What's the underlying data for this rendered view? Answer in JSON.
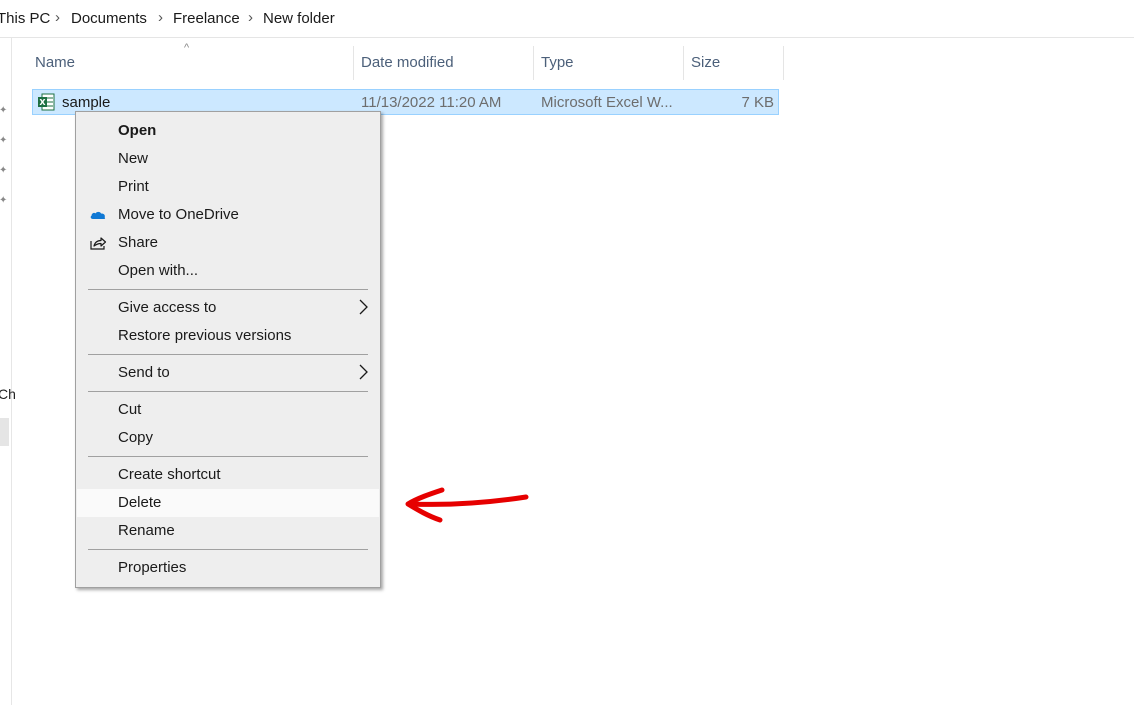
{
  "breadcrumb": {
    "items": [
      "This PC",
      "Documents",
      "Freelance",
      "New folder"
    ]
  },
  "nav": {
    "partial_text": "Ch"
  },
  "columns": {
    "name": "Name",
    "date_modified": "Date modified",
    "type": "Type",
    "size": "Size"
  },
  "file": {
    "name": "sample",
    "date_modified": "11/13/2022 11:20 AM",
    "type": "Microsoft Excel W...",
    "size": "7 KB",
    "icon": "excel-file-icon"
  },
  "context_menu": {
    "items": [
      {
        "label": "Open",
        "bold": true
      },
      {
        "label": "New"
      },
      {
        "label": "Print"
      },
      {
        "label": "Move to OneDrive",
        "icon": "onedrive-icon"
      },
      {
        "label": "Share",
        "icon": "share-icon"
      },
      {
        "label": "Open with..."
      },
      {
        "label": "Give access to",
        "submenu": true
      },
      {
        "label": "Restore previous versions"
      },
      {
        "label": "Send to",
        "submenu": true
      },
      {
        "label": "Cut"
      },
      {
        "label": "Copy"
      },
      {
        "label": "Create shortcut"
      },
      {
        "label": "Delete",
        "highlighted": true
      },
      {
        "label": "Rename"
      },
      {
        "label": "Properties"
      }
    ]
  },
  "colors": {
    "selection_bg": "#cce8ff",
    "selection_border": "#99d1ff",
    "menu_bg": "#eeeeee",
    "arrow": "#e60000",
    "onedrive": "#0f78d4",
    "excel": "#1d6f42"
  }
}
